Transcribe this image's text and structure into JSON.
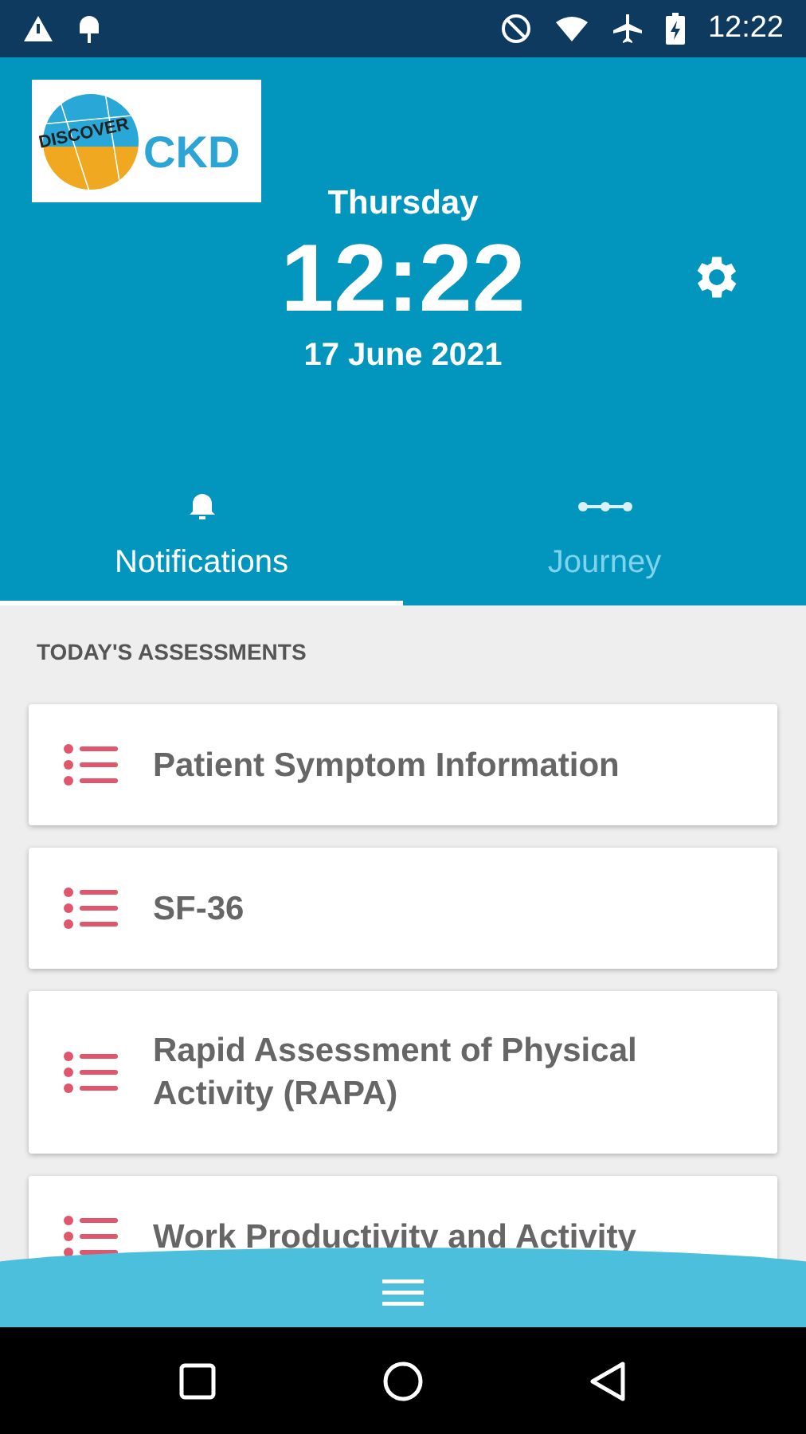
{
  "status_bar": {
    "time": "12:22"
  },
  "logo": {
    "word_1": "DISCOVER",
    "word_2": "CKD"
  },
  "header": {
    "day": "Thursday",
    "clock": "12:22",
    "date": "17 June 2021"
  },
  "tabs": [
    {
      "label": "Notifications",
      "selected": true
    },
    {
      "label": "Journey",
      "selected": false
    }
  ],
  "section_title": "TODAY'S ASSESSMENTS",
  "assessments": [
    {
      "title": "Patient Symptom Information"
    },
    {
      "title": "SF-36"
    },
    {
      "title": "Rapid Assessment of Physical Activity (RAPA)"
    },
    {
      "title": "Work Productivity and Activity"
    }
  ]
}
